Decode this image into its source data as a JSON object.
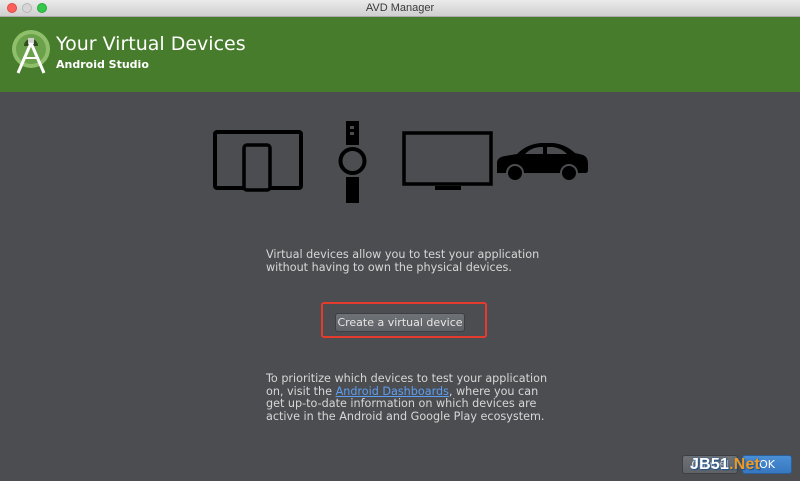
{
  "window": {
    "title": "AVD Manager"
  },
  "header": {
    "title": "Your Virtual Devices",
    "subtitle": "Android Studio"
  },
  "device_icons": [
    "tablet-icon",
    "watch-icon",
    "tv-icon",
    "car-icon"
  ],
  "intro": {
    "line1": "Virtual devices allow you to test your application",
    "line2": "without having to own the physical devices."
  },
  "create_button": {
    "label": "Create a virtual device"
  },
  "info": {
    "line1": "To prioritize which devices to test your application",
    "line2_prefix": "on, visit the ",
    "link": "Android Dashboards",
    "line2_suffix": ", where you can",
    "line3": "get up-to-date information on which devices are",
    "line4": "active in the Android and Google Play ecosystem."
  },
  "footer": {
    "cancel_label": "Cancel",
    "ok_label": "OK"
  },
  "watermark": {
    "part1": "JB51",
    "part2": ".Net"
  },
  "colors": {
    "header_bg": "#467c2c",
    "body_bg": "#4b4d50",
    "highlight": "#e53b2c",
    "link": "#5c9ef3"
  }
}
